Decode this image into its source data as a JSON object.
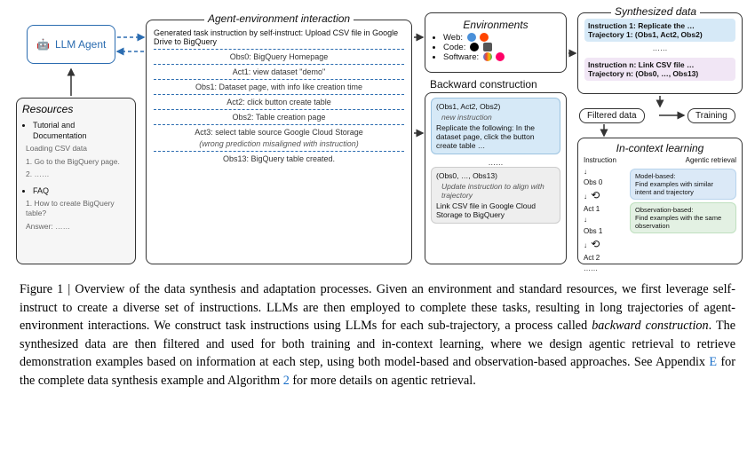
{
  "agent": {
    "label": "LLM Agent"
  },
  "resources": {
    "title": "Resources",
    "item1": "Tutorial and Documentation",
    "sub1a": "Loading CSV data",
    "sub1b": "1. Go to the BigQuery page.",
    "sub1c": "2. ……",
    "item2": "FAQ",
    "sub2a": "1. How to create BigQuery table?",
    "sub2b": "Answer: ……"
  },
  "interaction": {
    "title": "Agent-environment interaction",
    "gen": "Generated task instruction by self-instruct: Upload CSV file in Google Drive to BigQuery",
    "obs0": "Obs0: BigQuery Homepage",
    "act1": "Act1: view dataset \"demo\"",
    "obs1": "Obs1: Dataset page, with info like creation time",
    "act2": "Act2: click button create table",
    "obs2": "Obs2: Table creation page",
    "act3": "Act3: select table source Google Cloud Storage",
    "act3_note": "(wrong prediction misaligned with instruction)",
    "obs13": "Obs13: BigQuery table created."
  },
  "environments": {
    "title": "Environments",
    "web": "Web:",
    "code": "Code:",
    "software": "Software:"
  },
  "backward": {
    "title": "Backward construction",
    "chip1": "(Obs1, Act2, Obs2)",
    "chip1_note": "new instruction",
    "chip1_text": "Replicate the following: In the dataset page, click the button create table …",
    "dots": "……",
    "chip2": "(Obs0, …, Obs13)",
    "chip2_note": "Update instruction to align with trajectory",
    "chip2_text": "Link CSV file in Google Cloud Storage to BigQuery"
  },
  "synth": {
    "title": "Synthesized data",
    "i1": "Instruction 1: Replicate the …",
    "t1": "Trajectory 1: (Obs1, Act2, Obs2)",
    "dots": "……",
    "in": "Instruction n: Link CSV file …",
    "tn": "Trajectory n: (Obs0, …, Obs13)"
  },
  "flow": {
    "filtered": "Filtered data",
    "training": "Training"
  },
  "icl": {
    "title": "In-context learning",
    "left_hdr": "Instruction",
    "right_hdr": "Agentic retrieval",
    "obs0": "Obs 0",
    "act1": "Act 1",
    "obs1": "Obs 1",
    "act2": "Act 2",
    "dots": "……",
    "model": "Model-based:\nFind examples with similar intent and trajectory",
    "obsb": "Observation-based:\nFind examples with the same observation"
  },
  "caption": {
    "fignum": "Figure 1",
    "sep": " | ",
    "title": "Overview of the data synthesis and adaptation processes.",
    "body": "Given an environment and standard resources, we first leverage self-instruct to create a diverse set of instructions. LLMs are then employed to complete these tasks, resulting in long trajectories of agent-environment interactions. We construct task instructions using LLMs for each sub-trajectory, a process called ",
    "em": "backward construction",
    "body2": ". The synthesized data are then filtered and used for both training and in-context learning, where we design agentic retrieval to retrieve demonstration examples based on information at each step, using both model-based and observation-based approaches. See Appendix ",
    "linkE": "E",
    "body3": " for the complete data synthesis example and Algorithm ",
    "link2": "2",
    "body4": " for more details on agentic retrieval."
  }
}
